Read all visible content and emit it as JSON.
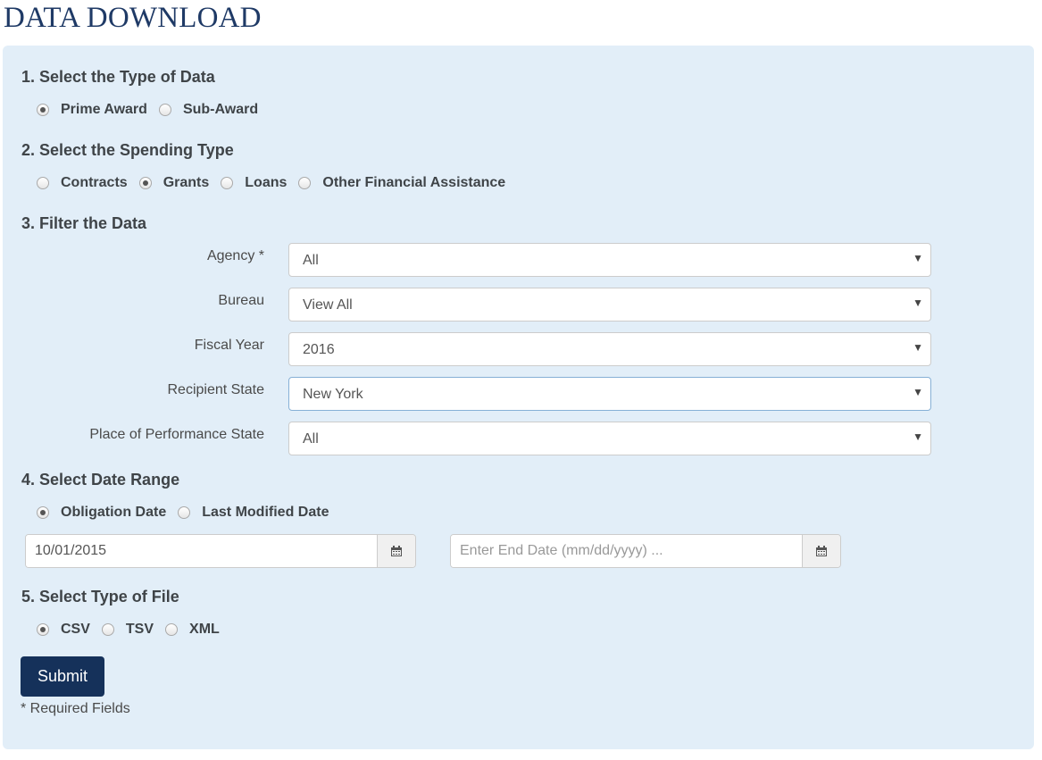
{
  "page": {
    "title": "DATA DOWNLOAD"
  },
  "section1": {
    "heading": "1. Select the Type of Data",
    "options": [
      {
        "label": "Prime Award",
        "checked": true
      },
      {
        "label": "Sub-Award",
        "checked": false
      }
    ]
  },
  "section2": {
    "heading": "2. Select the Spending Type",
    "options": [
      {
        "label": "Contracts",
        "checked": false
      },
      {
        "label": "Grants",
        "checked": true
      },
      {
        "label": "Loans",
        "checked": false
      },
      {
        "label": "Other Financial Assistance",
        "checked": false
      }
    ]
  },
  "section3": {
    "heading": "3. Filter the Data",
    "filters": [
      {
        "label": "Agency *",
        "value": "All"
      },
      {
        "label": "Bureau",
        "value": "View All"
      },
      {
        "label": "Fiscal Year",
        "value": "2016"
      },
      {
        "label": "Recipient State",
        "value": "New York"
      },
      {
        "label": "Place of Performance State",
        "value": "All"
      }
    ]
  },
  "section4": {
    "heading": "4. Select Date Range",
    "options": [
      {
        "label": "Obligation Date",
        "checked": true
      },
      {
        "label": "Last Modified Date",
        "checked": false
      }
    ],
    "start_date": {
      "value": "10/01/2015",
      "placeholder": ""
    },
    "end_date": {
      "value": "",
      "placeholder": "Enter End Date (mm/dd/yyyy) ..."
    },
    "calendar_icon": "calendar-icon"
  },
  "section5": {
    "heading": "5. Select Type of File",
    "options": [
      {
        "label": "CSV",
        "checked": true
      },
      {
        "label": "TSV",
        "checked": false
      },
      {
        "label": "XML",
        "checked": false
      }
    ]
  },
  "submit_label": "Submit",
  "required_note": "* Required Fields",
  "colors": {
    "title": "#1f3a66",
    "panel_background": "#e2eef8",
    "submit_background": "#15315a"
  }
}
